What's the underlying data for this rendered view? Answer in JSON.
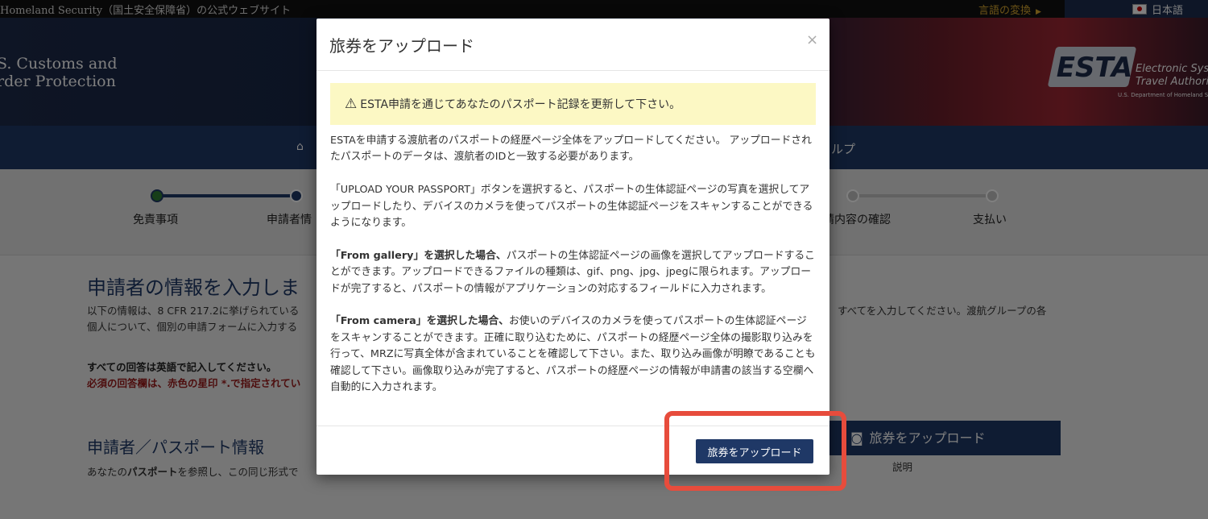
{
  "topbar": {
    "gov_text": "Homeland Security（国土安全保障省）の公式ウェブサイト",
    "translate_label": "言語の変換",
    "language_label": "日本語"
  },
  "header": {
    "brand_line1": "S. Customs and",
    "brand_line2": "rder Protection",
    "esta_logo": "ESTA",
    "esta_line1": "Electronic Syst",
    "esta_line2": "Travel Authoriz",
    "esta_dept": "U.S. Department of Homeland Securi"
  },
  "nav": {
    "help_label": "ルプ"
  },
  "steps": [
    {
      "label": "免責事項",
      "state": "done"
    },
    {
      "label": "申請者情",
      "state": "current"
    },
    {
      "label": "請内容の確認",
      "state": "todo"
    },
    {
      "label": "支払い",
      "state": "todo"
    }
  ],
  "page": {
    "title": "申請者の情報を入力しま",
    "intro_line1": "以下の情報は、8 CFR 217.2に挙げられている",
    "intro_line2": "個人について、個別の申請フォームに入力する",
    "intro_right": "すべてを入力してください。渡航グループの各",
    "english_note": "すべての回答は英語で記入してください。",
    "required_note": "必須の回答欄は、赤色の星印 *.で指定されてい",
    "section_title": "申請者／パスポート情報",
    "section_desc_prefix": "あなたの",
    "section_desc_bold": "パスポート",
    "section_desc_suffix": "を参照し、この同じ形式で",
    "upload_passport_button": "旅券をアップロード",
    "explain_link": "説明"
  },
  "modal": {
    "title": "旅券をアップロード",
    "close": "×",
    "warning": "ESTA申請を通じてあなたのパスポート記録を更新して下さい。",
    "para1": "ESTAを申請する渡航者のパスポートの経歴ページ全体をアップロードしてください。 アップロードされたパスポートのデータは、渡航者のIDと一致する必要があります。",
    "para2": "「UPLOAD YOUR PASSPORT」ボタンを選択すると、パスポートの生体認証ページの写真を選択してアップロードしたり、デバイスのカメラを使ってパスポートの生体認証ページをスキャンすることができるようになります。",
    "para3_bold": "「From gallery」を選択した場合、",
    "para3": "パスポートの生体認証ページの画像を選択してアップロードすることができます。アップロードできるファイルの種類は、gif、png、jpg、jpegに限られます。アップロードが完了すると、パスポートの情報がアプリケーションの対応するフィールドに入力されます。",
    "para4_bold": "「From camera」を選択した場合、",
    "para4": "お使いのデバイスのカメラを使ってパスポートの生体認証ページをスキャンすることができます。正確に取り込むために、パスポートの経歴ページ全体の撮影取り込みを行って、MRZに写真全体が含まれていることを確認して下さい。また、取り込み画像が明瞭であることも確認して下さい。画像取り込みが完了すると、パスポートの経歴ページの情報が申請書の該当する空欄へ自動的に入力されます。",
    "upload_button": "旅券をアップロード"
  },
  "colors": {
    "navy": "#1f3866",
    "warning_bg": "#fcf8c4",
    "highlight": "#e74c3c",
    "step_done": "#2e7d32"
  }
}
